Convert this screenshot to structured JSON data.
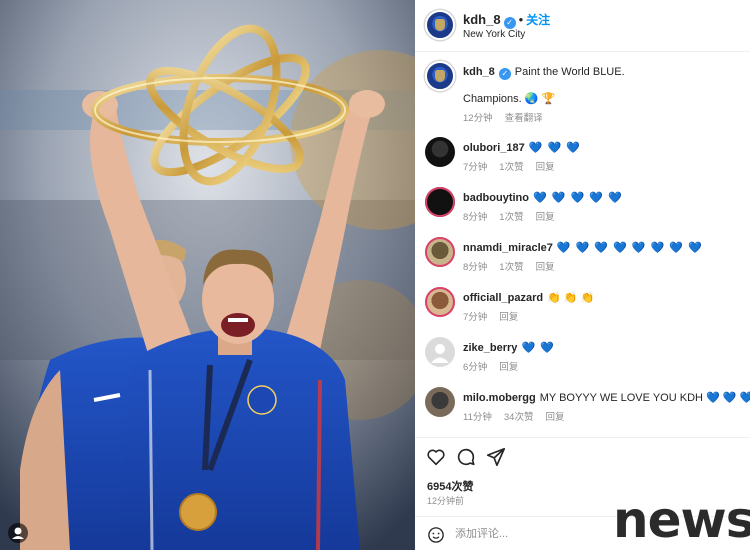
{
  "post": {
    "author": "kdh_8",
    "verified_mark": "✓",
    "dot": "•",
    "follow_label": "关注",
    "location": "New York City",
    "caption_line1": "Paint the World BLUE.",
    "caption_line2": "Champions. 🌏 🏆",
    "caption_time": "12分钟",
    "translate_label": "查看翻译"
  },
  "comments": [
    {
      "user": "olubori_187",
      "text": "💙 💙 💙",
      "time": "7分钟",
      "likes": "1次赞",
      "reply": "回复"
    },
    {
      "user": "badbouytino",
      "text": "💙 💙 💙 💙 💙",
      "time": "8分钟",
      "likes": "1次赞",
      "reply": "回复"
    },
    {
      "user": "nnamdi_miracle7",
      "text": "💙 💙 💙 💙 💙 💙 💙 💙",
      "time": "8分钟",
      "likes": "1次赞",
      "reply": "回复"
    },
    {
      "user": "officiall_pazard",
      "text": "👏 👏 👏",
      "time": "7分钟",
      "likes": "",
      "reply": "回复"
    },
    {
      "user": "zike_berry",
      "text": "💙 💙",
      "time": "6分钟",
      "likes": "",
      "reply": "回复"
    },
    {
      "user": "milo.mobergg",
      "text": "MY BOYYY WE LOVE YOU KDH 💙 💙 💙 💙",
      "time": "11分钟",
      "likes": "34次赞",
      "reply": "回复"
    }
  ],
  "actions": {
    "likes_count": "6954次赞",
    "post_time": "12分钟前",
    "comment_placeholder": "添加评论...",
    "icons": [
      "heart-icon",
      "comment-icon",
      "share-icon",
      "emoji-icon"
    ]
  },
  "watermark": "news",
  "colors": {
    "accent": "#0095f6",
    "verified": "#3897f0",
    "chelsea_blue": "#1f4fbf",
    "gold": "#d6b25a"
  }
}
